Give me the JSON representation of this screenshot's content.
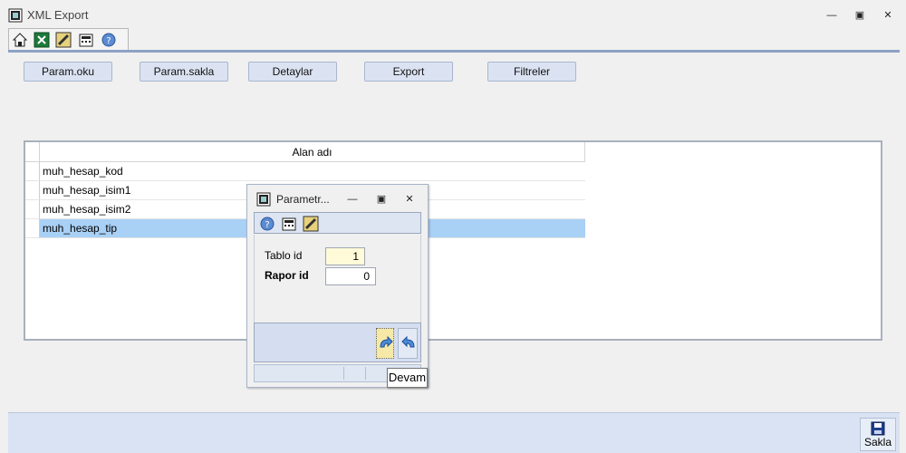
{
  "window": {
    "title": "XML Export",
    "minimize_glyph": "—",
    "restore_glyph": "▣",
    "close_glyph": "✕"
  },
  "toolbar": {
    "icons": [
      "home-icon",
      "excel-icon",
      "edit-icon",
      "calculator-icon",
      "help-icon"
    ]
  },
  "commands": {
    "param_oku": "Param.oku",
    "param_sakla": "Param.sakla",
    "detaylar": "Detaylar",
    "export": "Export",
    "filtreler": "Filtreler"
  },
  "grid": {
    "column_header": "Alan adı",
    "rows": [
      "muh_hesap_kod",
      "muh_hesap_isim1",
      "muh_hesap_isim2",
      "muh_hesap_tip"
    ],
    "selected_row": 3
  },
  "bottom": {
    "save_label": "Sakla"
  },
  "dialog": {
    "title": "Parametr...",
    "fields": {
      "tablo_id_label": "Tablo id",
      "tablo_id_value": "1",
      "rapor_id_label": "Rapor id",
      "rapor_id_value": "0"
    },
    "tooltip": "Devam"
  },
  "colors": {
    "accent": "#8ea1c4",
    "selected_row": "#a9d0f5",
    "button_bg": "#dbe3f2"
  }
}
